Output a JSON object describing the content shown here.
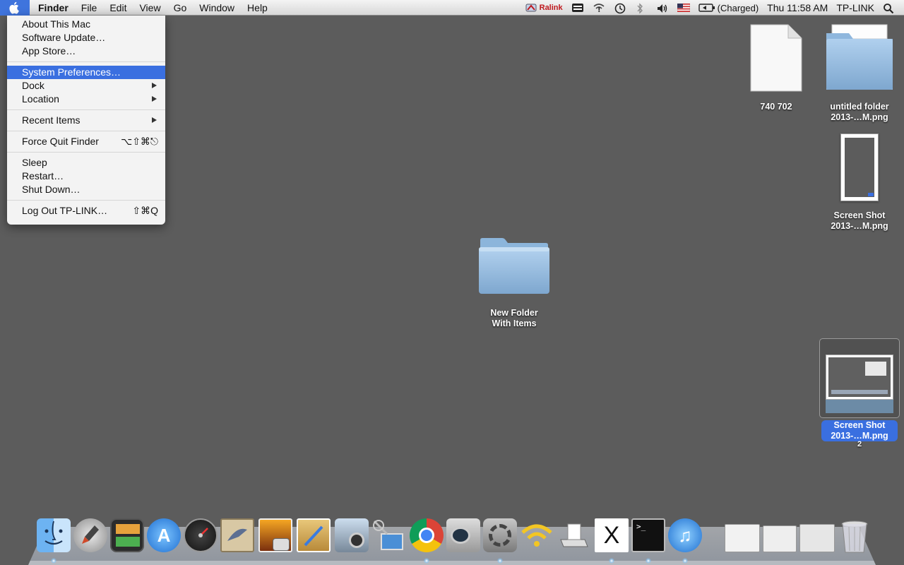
{
  "menubar": {
    "app": "Finder",
    "menus": [
      "File",
      "Edit",
      "View",
      "Go",
      "Window",
      "Help"
    ],
    "status": {
      "ralink": "Ralink",
      "battery": "(Charged)",
      "clock": "Thu 11:58 AM",
      "user": "TP-LINK"
    }
  },
  "apple_menu": {
    "items": {
      "about": "About This Mac",
      "software_update": "Software Update…",
      "app_store": "App Store…",
      "system_prefs": "System Preferences…",
      "dock": "Dock",
      "location": "Location",
      "recent": "Recent Items",
      "force_quit": "Force Quit Finder",
      "force_quit_shortcut": "⌥⇧⌘⎋",
      "sleep": "Sleep",
      "restart": "Restart…",
      "shutdown": "Shut Down…",
      "logout": "Log Out TP-LINK…",
      "logout_shortcut": "⇧⌘Q"
    }
  },
  "desktop": {
    "doc_file": "740 702",
    "top_right_label_1": "untitled folder",
    "top_right_label_2": "2013-…M.png",
    "screenshot_1_line1": "Screen Shot",
    "screenshot_1_line2": "2013-…M.png",
    "new_folder_line1": "New Folder",
    "new_folder_line2": "With Items",
    "selected_line1": "Screen Shot",
    "selected_line2": "2013-…M.png",
    "selected_badge": "2"
  },
  "colors": {
    "desktop": "#5c5c5c",
    "highlight": "#3a6fe0"
  },
  "dock_icons": [
    "finder-icon",
    "launchpad-icon",
    "photo-booth-icon",
    "app-store-icon",
    "dashboard-icon",
    "mail-icon",
    "iphoto-icon",
    "preview-icon",
    "image-capture-icon",
    "remote-desktop-icon",
    "chrome-icon",
    "facetime-icon",
    "system-preferences-icon",
    "wifi-icon",
    "printer-icon",
    "x11-icon",
    "terminal-icon",
    "itunes-icon",
    "stack-1-icon",
    "stack-2-icon",
    "stack-3-icon",
    "trash-icon"
  ]
}
